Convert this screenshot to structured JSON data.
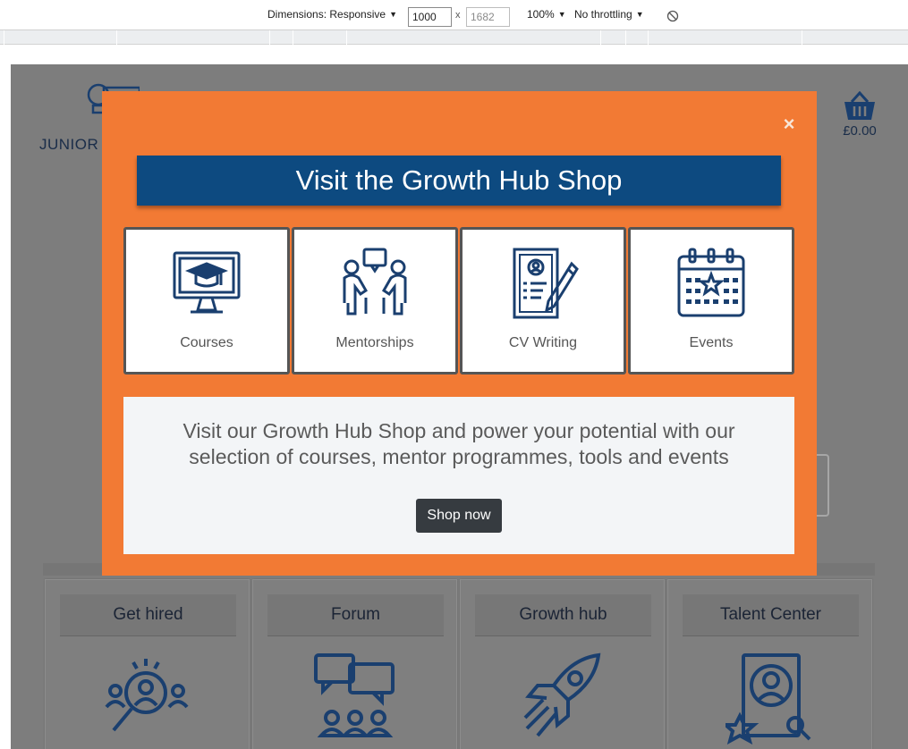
{
  "devtools": {
    "dimensions_label": "Dimensions: Responsive",
    "width_value": "1000",
    "height_placeholder": "1682",
    "times": "x",
    "zoom": "100%",
    "throttling": "No throttling",
    "caret": "▼",
    "rotate_icon": "rotate-icon"
  },
  "page": {
    "brand": "JUNIOR",
    "cart_price": "£0.00",
    "cards": [
      {
        "title": "Get hired",
        "icon": "candidate-search-icon"
      },
      {
        "title": "Forum",
        "icon": "chat-group-icon"
      },
      {
        "title": "Growth hub",
        "icon": "rocket-icon"
      },
      {
        "title": "Talent Center",
        "icon": "award-profile-icon"
      }
    ]
  },
  "modal": {
    "close": "×",
    "heading": "Visit the Growth Hub Shop",
    "tiles": [
      {
        "label": "Courses",
        "icon": "graduation-monitor-icon"
      },
      {
        "label": "Mentorships",
        "icon": "mentorship-icon"
      },
      {
        "label": "CV Writing",
        "icon": "cv-writing-icon"
      },
      {
        "label": "Events",
        "icon": "calendar-events-icon"
      }
    ],
    "description": "Visit our Growth Hub Shop and power your potential with our selection of courses, mentor programmes, tools and events",
    "button": "Shop now"
  },
  "colors": {
    "accent_orange": "#f27a34",
    "brand_navy": "#0d4a80",
    "icon_navy": "#1a3f6f",
    "button_dark": "#363b40"
  }
}
